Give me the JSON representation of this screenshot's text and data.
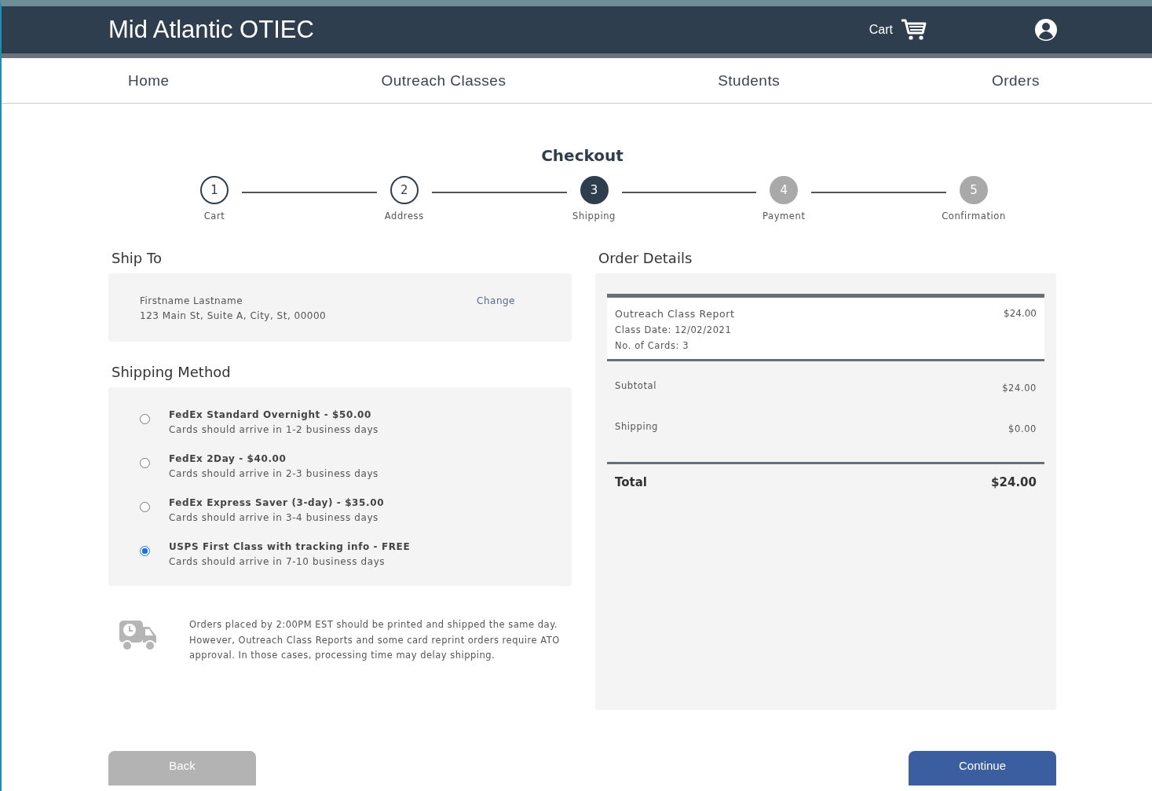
{
  "header": {
    "title": "Mid Atlantic OTIEC",
    "cart_label": "Cart"
  },
  "nav": [
    {
      "label": "Home"
    },
    {
      "label": "Outreach Classes"
    },
    {
      "label": "Students"
    },
    {
      "label": "Orders"
    }
  ],
  "page_title": "Checkout",
  "steps": [
    {
      "number": "1",
      "label": "Cart",
      "kind": "done"
    },
    {
      "number": "2",
      "label": "Address",
      "kind": "done"
    },
    {
      "number": "3",
      "label": "Shipping",
      "kind": "current"
    },
    {
      "number": "4",
      "label": "Payment",
      "kind": "upcoming"
    },
    {
      "number": "5",
      "label": "Confirmation",
      "kind": "upcoming"
    }
  ],
  "ship_to": {
    "heading": "Ship To",
    "name": "Firstname Lastname",
    "address": "123 Main St, Suite A, City,  St,  00000",
    "change_link": "Change"
  },
  "shipping_method": {
    "heading": "Shipping Method",
    "options": [
      {
        "title": "FedEx Standard Overnight - $50.00",
        "detail": "Cards should arrive in 1-2 business days",
        "selected": false
      },
      {
        "title": "FedEx 2Day - $40.00",
        "detail": "Cards should arrive in 2-3 business days",
        "selected": false
      },
      {
        "title": "FedEx Express Saver (3-day) - $35.00",
        "detail": "Cards should arrive in 3-4 business days",
        "selected": false
      },
      {
        "title": "USPS First Class with tracking info - FREE",
        "detail": "Cards should arrive in 7-10 business days",
        "selected": true
      }
    ]
  },
  "notice": "Orders placed by 2:00PM EST should be printed and shipped the same day. However, Outreach Class Reports and some card reprint orders require ATO approval. In those cases, processing time may delay shipping.",
  "order_details": {
    "heading": "Order Details",
    "item": {
      "name": "Outreach Class Report",
      "class_date": "Class Date: 12/02/2021",
      "cards": "No. of Cards: 3",
      "price": "$24.00"
    },
    "subtotal_label": "Subtotal",
    "subtotal": "$24.00",
    "shipping_label": "Shipping",
    "shipping": "$0.00",
    "total_label": "Total",
    "total": "$24.00"
  },
  "buttons": {
    "back": "Back",
    "continue": "Continue"
  }
}
